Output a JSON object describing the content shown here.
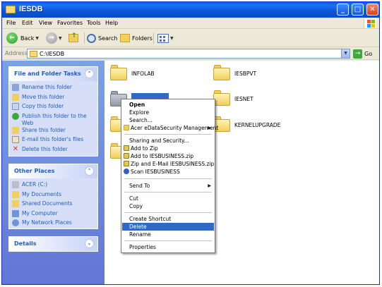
{
  "window": {
    "title": "IESDB"
  },
  "menubar": {
    "items": [
      "File",
      "Edit",
      "View",
      "Favorites",
      "Tools",
      "Help"
    ]
  },
  "toolbar": {
    "back_label": "Back",
    "search_label": "Search",
    "folders_label": "Folders"
  },
  "address": {
    "label": "Address",
    "value": "C:\\IESDB",
    "go_label": "Go"
  },
  "tasks_panel": {
    "title": "File and Folder Tasks",
    "items": [
      "Rename this folder",
      "Move this folder",
      "Copy this folder",
      "Publish this folder to the Web",
      "Share this folder",
      "E-mail this folder's files",
      "Delete this folder"
    ]
  },
  "places_panel": {
    "title": "Other Places",
    "items": [
      "ACER (C:)",
      "My Documents",
      "Shared Documents",
      "My Computer",
      "My Network Places"
    ]
  },
  "details_panel": {
    "title": "Details"
  },
  "folders": [
    "INFOLAB",
    "IESBPVT",
    "IESBUSINESS",
    "IESNET",
    "KERNELUPGRADE"
  ],
  "context_menu": {
    "items": [
      "Open",
      "Explore",
      "Search...",
      "Acer eDataSecurity Management",
      "Sharing and Security...",
      "Add to Zip",
      "Add to IESBUSINESS.zip",
      "Zip and E-Mail IESBUSINESS.zip",
      "Scan IESBUSINESS",
      "Send To",
      "Cut",
      "Copy",
      "Create Shortcut",
      "Delete",
      "Rename",
      "Properties"
    ]
  },
  "colors": {
    "titlebar": "#0a5ee8",
    "selection": "#316ac5",
    "task_link": "#215dc6"
  }
}
